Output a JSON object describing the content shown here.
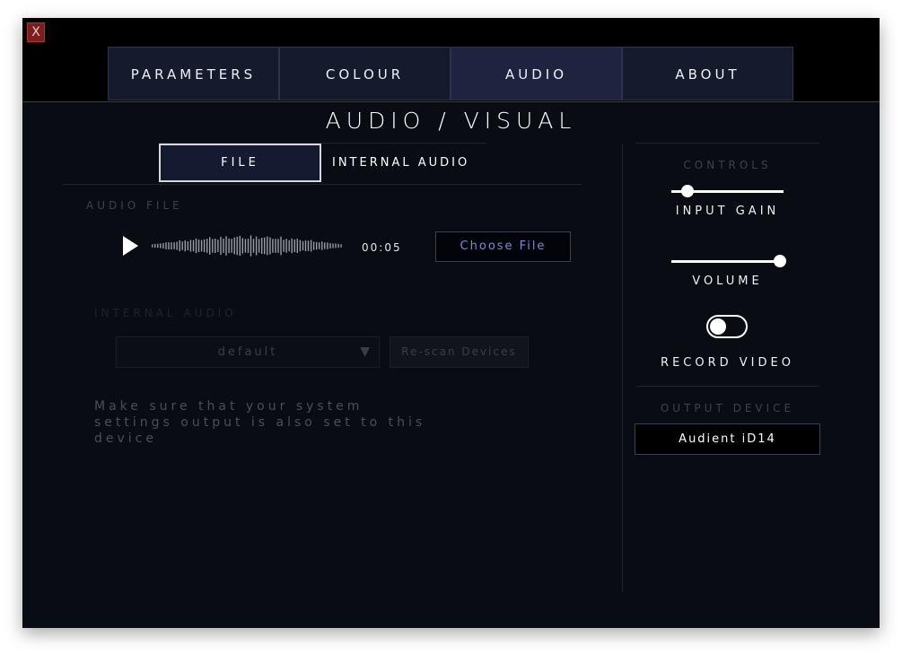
{
  "window": {
    "close_label": "X"
  },
  "tabs": [
    {
      "label": "PARAMETERS",
      "active": false
    },
    {
      "label": "COLOUR",
      "active": false
    },
    {
      "label": "AUDIO",
      "active": true
    },
    {
      "label": "ABOUT",
      "active": false
    }
  ],
  "page_title": "AUDIO / VISUAL",
  "mode": {
    "file_label": "FILE",
    "internal_label": "INTERNAL AUDIO",
    "selected": "FILE"
  },
  "audio_file": {
    "section_label": "AUDIO FILE",
    "time": "00:05",
    "choose_label": "Choose File",
    "play_icon": "play-icon"
  },
  "internal_audio": {
    "section_label": "INTERNAL AUDIO",
    "device_value": "default",
    "rescan_label": "Re-scan Devices",
    "hint": "Make sure that your system settings output is also set to this device"
  },
  "controls": {
    "section_label": "CONTROLS",
    "input_gain": {
      "label": "INPUT GAIN",
      "value": 0.14
    },
    "volume": {
      "label": "VOLUME",
      "value": 0.97
    },
    "record_video": {
      "label": "RECORD VIDEO",
      "on": false
    }
  },
  "output": {
    "section_label": "OUTPUT DEVICE",
    "device": "Audient iD14"
  },
  "colors": {
    "accent": "#8088d8",
    "active_tab": "#1e2440",
    "background": "#0a0c14"
  }
}
